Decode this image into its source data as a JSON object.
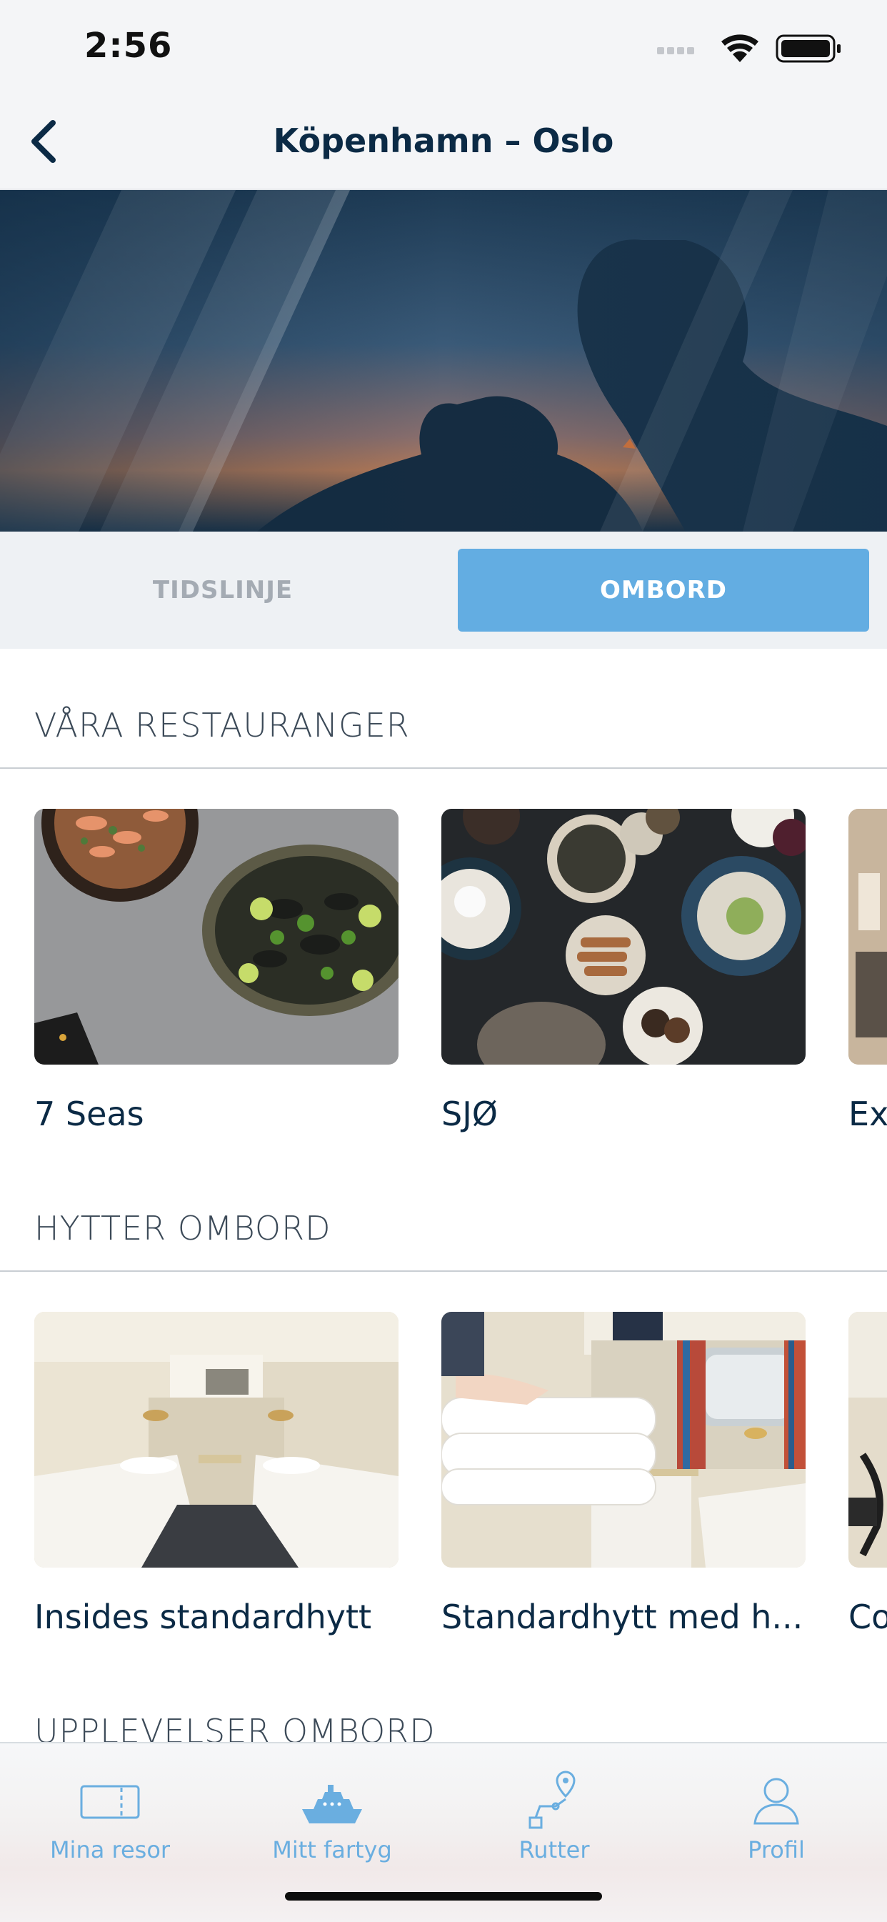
{
  "status_bar": {
    "time": "2:56"
  },
  "nav": {
    "title": "Köpenhamn – Oslo"
  },
  "tabs": [
    {
      "label": "TIDSLINJE",
      "selected": false
    },
    {
      "label": "OMBORD",
      "selected": true
    }
  ],
  "sections": {
    "restaurants": {
      "title": "VÅRA RESTAURANGER",
      "items": [
        "7 Seas",
        "SJØ",
        "Ex"
      ]
    },
    "cabins": {
      "title": "HYTTER OMBORD",
      "items": [
        "Insides standardhytt",
        "Standardhytt med h...",
        "Co"
      ]
    },
    "experiences": {
      "title": "UPPLEVELSER OMBORD"
    }
  },
  "tab_bar": {
    "items": [
      {
        "label": "Mina resor",
        "icon": "ticket-icon"
      },
      {
        "label": "Mitt fartyg",
        "icon": "ship-icon"
      },
      {
        "label": "Rutter",
        "icon": "route-icon"
      },
      {
        "label": "Profil",
        "icon": "profile-icon"
      }
    ]
  },
  "colors": {
    "accent": "#63ade2",
    "title": "#0b2a45",
    "tab_bar_text": "#6aaee0"
  }
}
